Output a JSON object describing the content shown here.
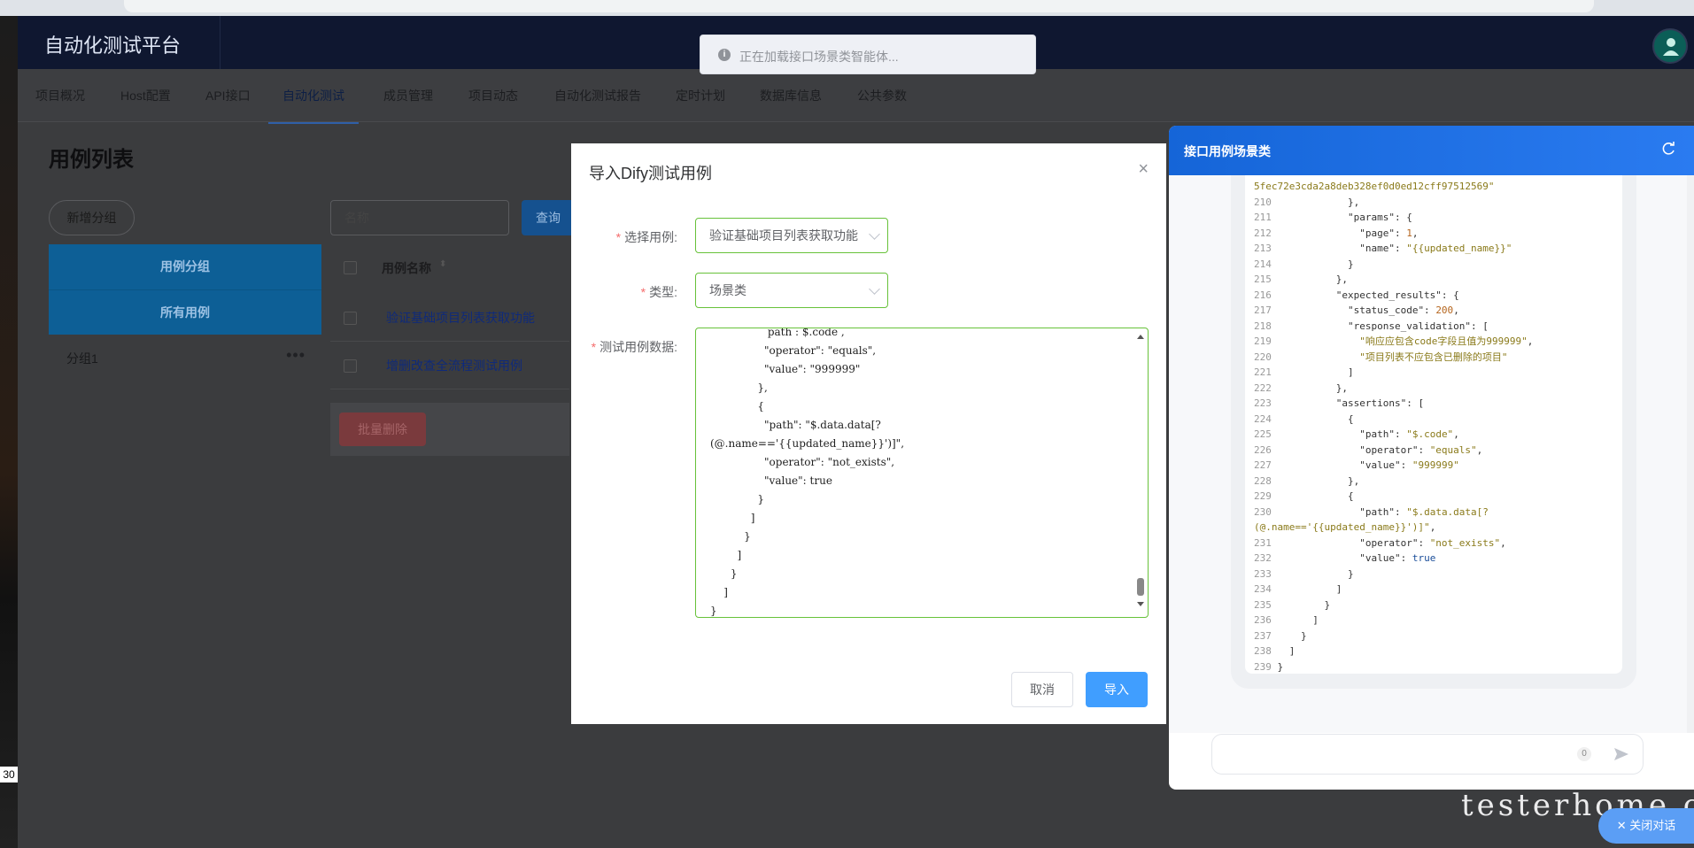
{
  "left_tag": "30",
  "header": {
    "logo": "自动化测试平台"
  },
  "toast": {
    "text": "正在加载接口场景类智能体..."
  },
  "nav": [
    "项目概况",
    "Host配置",
    "API接口",
    "自动化测试",
    "成员管理",
    "项目动态",
    "自动化测试报告",
    "定时计划",
    "数据库信息",
    "公共参数"
  ],
  "page": {
    "title": "用例列表",
    "add_group": "新增分组",
    "group_header": "用例分组",
    "all_cases": "所有用例",
    "group_1": "分组1",
    "group_more": "•••",
    "search_placeholder": "名称",
    "query": "查询",
    "col_name": "用例名称",
    "rows": [
      "验证基础项目列表获取功能",
      "增删改查全流程测试用例"
    ],
    "batch_delete": "批量删除"
  },
  "dialog": {
    "title": "导入Dify测试用例",
    "close": "×",
    "label_case": "选择用例:",
    "label_type": "类型:",
    "label_data": "测试用例数据:",
    "case_value": "验证基础项目列表获取功能",
    "type_value": "场景类",
    "data_text": "                 path : $.code ,\n                \"operator\": \"equals\",\n                \"value\": \"999999\"\n              },\n              {\n                \"path\": \"$.data.data[?\n(@.name=='{{updated_name}}')]\",\n                \"operator\": \"not_exists\",\n                \"value\": true\n              }\n            ]\n          }\n        ]\n      }\n    ]\n}",
    "cancel": "取消",
    "import": "导入"
  },
  "chat": {
    "title": "接口用例场景类",
    "counter": "0",
    "close": "关闭对话"
  },
  "watermark": "testerhome.com"
}
